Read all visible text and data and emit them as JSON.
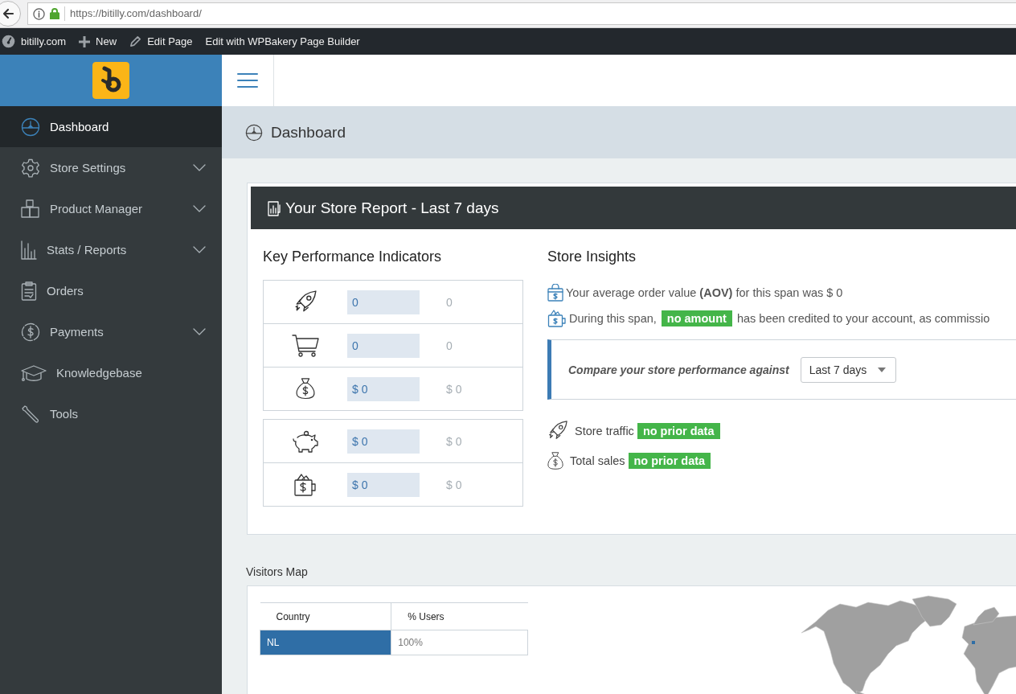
{
  "browser": {
    "url": "https://bitilly.com/dashboard/"
  },
  "admin_bar": {
    "items": [
      "bitilly.com",
      "New",
      "Edit Page",
      "Edit with WPBakery Page Builder"
    ]
  },
  "sidebar": {
    "items": [
      {
        "label": "Dashboard",
        "selected": true,
        "has_submenu": false
      },
      {
        "label": "Store Settings",
        "selected": false,
        "has_submenu": true
      },
      {
        "label": "Product Manager",
        "selected": false,
        "has_submenu": true
      },
      {
        "label": "Stats / Reports",
        "selected": false,
        "has_submenu": true
      },
      {
        "label": "Orders",
        "selected": false,
        "has_submenu": false
      },
      {
        "label": "Payments",
        "selected": false,
        "has_submenu": true
      },
      {
        "label": "Knowledgebase",
        "selected": false,
        "has_submenu": false
      },
      {
        "label": "Tools",
        "selected": false,
        "has_submenu": false
      }
    ]
  },
  "breadcrumb": {
    "title": "Dashboard"
  },
  "report": {
    "title": "Your Store Report - Last 7 days",
    "kpi": {
      "title": "Key Performance Indicators",
      "groups": [
        {
          "rows": [
            {
              "current": "0",
              "previous": "0"
            },
            {
              "current": "0",
              "previous": "0"
            },
            {
              "current": "$ 0",
              "previous": "$ 0"
            }
          ]
        },
        {
          "rows": [
            {
              "current": "$ 0",
              "previous": "$ 0"
            },
            {
              "current": "$ 0",
              "previous": "$ 0"
            }
          ]
        }
      ]
    },
    "insights": {
      "title": "Store Insights",
      "aov": "Your average order value **(AOV)** for this span was $ 0",
      "credit": {
        "before": "During this span,",
        "badge": "no amount",
        "after": "has been credited to your account, as commissio"
      },
      "compare": {
        "label": "Compare your store performance against",
        "select": "Last 7 days"
      },
      "comparisons": [
        {
          "label": "Store traffic",
          "badge": "no prior data"
        },
        {
          "label": "Total sales",
          "badge": "no prior data"
        }
      ]
    }
  },
  "visitors_map": {
    "title": "Visitors Map",
    "columns": [
      "Country",
      "% Users"
    ],
    "rows": [
      {
        "cells": [
          "NL",
          "100%"
        ],
        "selected": true
      }
    ]
  }
}
